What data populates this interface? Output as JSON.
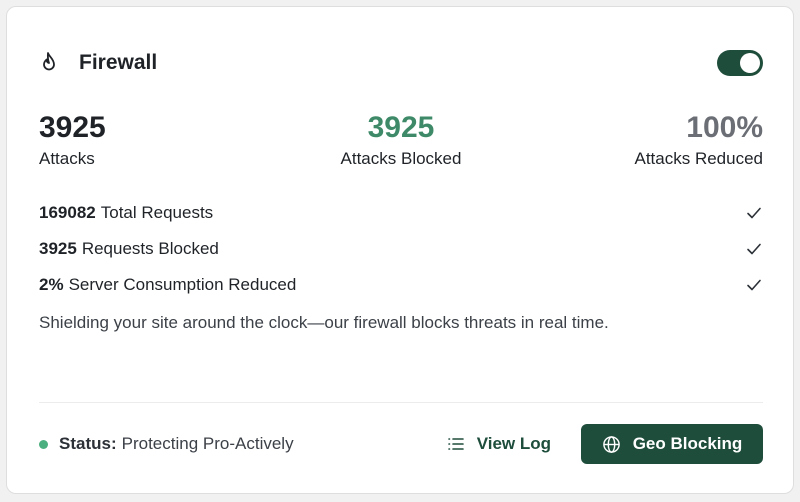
{
  "header": {
    "title": "Firewall",
    "enabled": true
  },
  "stats": [
    {
      "value": "3925",
      "label": "Attacks"
    },
    {
      "value": "3925",
      "label": "Attacks Blocked"
    },
    {
      "value": "100%",
      "label": "Attacks Reduced"
    }
  ],
  "checks": [
    {
      "value": "169082",
      "text": "Total Requests"
    },
    {
      "value": "3925",
      "text": "Requests Blocked"
    },
    {
      "value": "2%",
      "text": "Server Consumption Reduced"
    }
  ],
  "description": "Shielding your site around the clock—our firewall blocks threats in real time.",
  "footer": {
    "status_key": "Status:",
    "status_value": "Protecting Pro-Actively",
    "view_log_label": "View Log",
    "geo_label": "Geo Blocking"
  },
  "icons": {
    "flame": "flame-icon",
    "check": "check-icon",
    "list": "list-icon",
    "globe": "globe-icon"
  },
  "colors": {
    "accent": "#1f4d3b",
    "blocked_value": "#3e8a68",
    "reduced_value": "#6b6f75",
    "status_dot": "#4caf7f"
  }
}
